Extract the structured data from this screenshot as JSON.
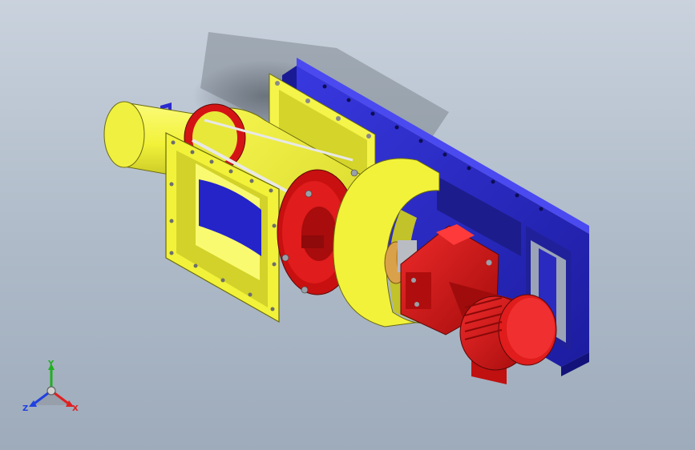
{
  "viewport": {
    "background_top": "#c9d2dd",
    "background_bottom": "#9eabbb"
  },
  "model": {
    "colors": {
      "housing_yellow": "#f2f23a",
      "housing_yellow_shade": "#c9c92a",
      "flange_red": "#d41414",
      "flange_red_dark": "#8f0a0a",
      "frame_blue": "#2a2acf",
      "frame_blue_dark": "#16168a",
      "bolt_gray": "#9aa0a8",
      "coupling_orange": "#d9a24a"
    }
  },
  "triad": {
    "x_label": "X",
    "y_label": "Y",
    "z_label": "Z",
    "x_color": "#e02020",
    "y_color": "#20b020",
    "z_color": "#2040e0"
  }
}
